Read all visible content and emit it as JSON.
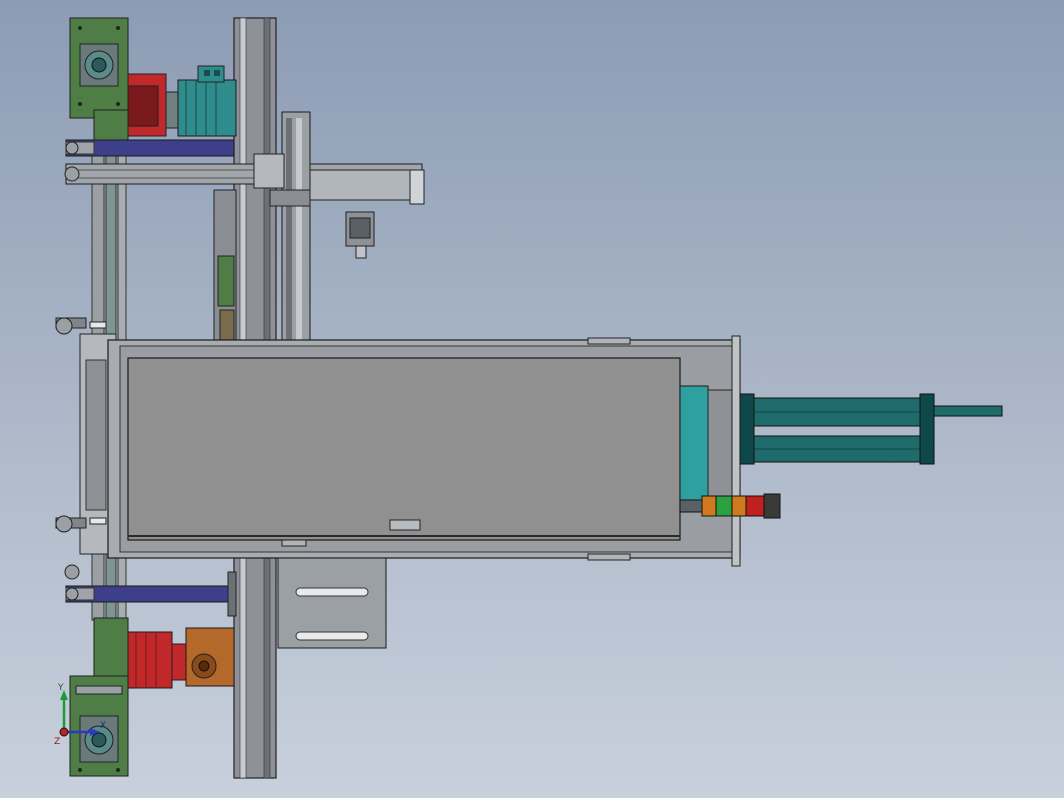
{
  "viewport": {
    "description_kind": "cad-assembly-top-view",
    "background_top": "#8c9cb4",
    "background_bottom": "#c8d0dc"
  },
  "colors": {
    "bracket_green": "#4e7d46",
    "motor_teal": "#2f8c8c",
    "gearbox_red": "#c0282a",
    "gearbox_orange": "#b4682a",
    "crossbar_blue": "#3d3f8a",
    "frame_gray": "#8e9298",
    "panel_gray": "#909090",
    "cylinder_teal": "#1f6a6a",
    "tower_green": "#2aa040",
    "tower_orange": "#d07a20",
    "tower_red": "#c02020"
  },
  "triad": {
    "y_label": "Y",
    "x_label": "X",
    "z_label": "Z"
  }
}
